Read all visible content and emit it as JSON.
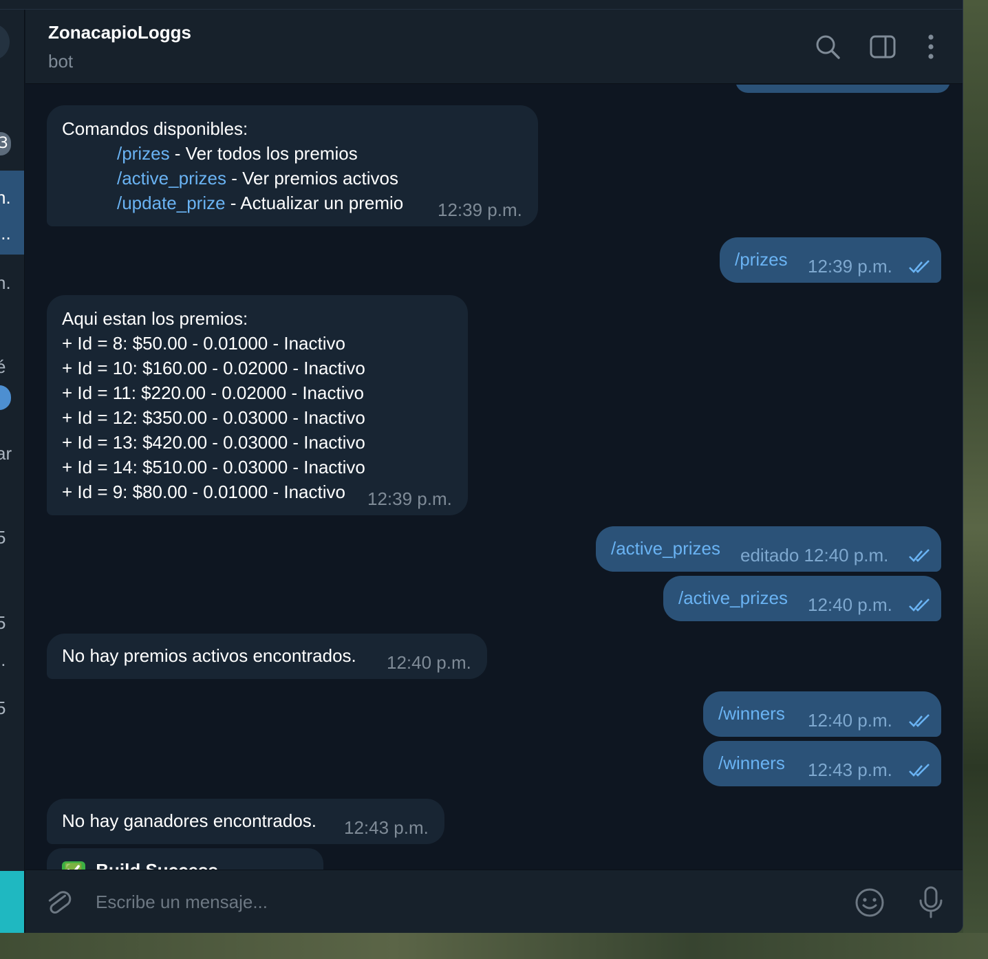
{
  "header": {
    "title": "ZonacapioLoggs",
    "subtitle": "bot",
    "icons": [
      "search-icon",
      "sidebar-toggle-icon",
      "more-vertical-icon"
    ]
  },
  "chatlist": {
    "badge": "3",
    "fragments": [
      "n.",
      "...",
      "n.",
      "é",
      "ar",
      ".",
      "5",
      "5",
      "..",
      "5"
    ]
  },
  "messages": [
    {
      "direction": "in",
      "title": "Comandos disponibles:",
      "commands": [
        {
          "cmd": "/prizes",
          "desc": " - Ver todos los premios"
        },
        {
          "cmd": "/active_prizes",
          "desc": " - Ver premios activos"
        },
        {
          "cmd": "/update_prize",
          "desc": " - Actualizar un premio"
        }
      ],
      "time": "12:39 p.m."
    },
    {
      "direction": "out",
      "text": "/prizes",
      "time": "12:39 p.m."
    },
    {
      "direction": "in",
      "lines": [
        "Aqui estan los premios:",
        "+ Id = 8: $50.00 - 0.01000 - Inactivo",
        "+ Id = 10: $160.00 - 0.02000 - Inactivo",
        "+ Id = 11: $220.00 - 0.02000 - Inactivo",
        "+ Id = 12: $350.00 - 0.03000 - Inactivo",
        "+ Id = 13: $420.00 - 0.03000 - Inactivo",
        "+ Id = 14: $510.00 - 0.03000 - Inactivo",
        "+ Id = 9: $80.00 - 0.01000 - Inactivo"
      ],
      "time": "12:39 p.m."
    },
    {
      "direction": "out",
      "text": "/active_prizes",
      "time": "editado 12:40 p.m."
    },
    {
      "direction": "out",
      "text": "/active_prizes",
      "time": "12:40 p.m."
    },
    {
      "direction": "in",
      "text": "No hay premios activos encontrados.",
      "time": "12:40 p.m."
    },
    {
      "direction": "out",
      "text": "/winners",
      "time": "12:40 p.m."
    },
    {
      "direction": "out",
      "text": "/winners",
      "time": "12:43 p.m."
    },
    {
      "direction": "in",
      "text": "No hay ganadores encontrados.",
      "time": "12:43 p.m."
    },
    {
      "direction": "in",
      "text": "Build Success",
      "emoji": "✅",
      "partial": true
    }
  ],
  "composer": {
    "placeholder": "Escribe un mensaje...",
    "icons": [
      "attach-icon",
      "emoji-icon",
      "microphone-icon"
    ]
  },
  "colors": {
    "background": "#0e1621",
    "panel": "#17212b",
    "incoming_bubble": "#182533",
    "outgoing_bubble": "#2b5278",
    "link": "#6ab3f3",
    "muted": "#7f8b97",
    "accent": "#1fb8c1"
  }
}
